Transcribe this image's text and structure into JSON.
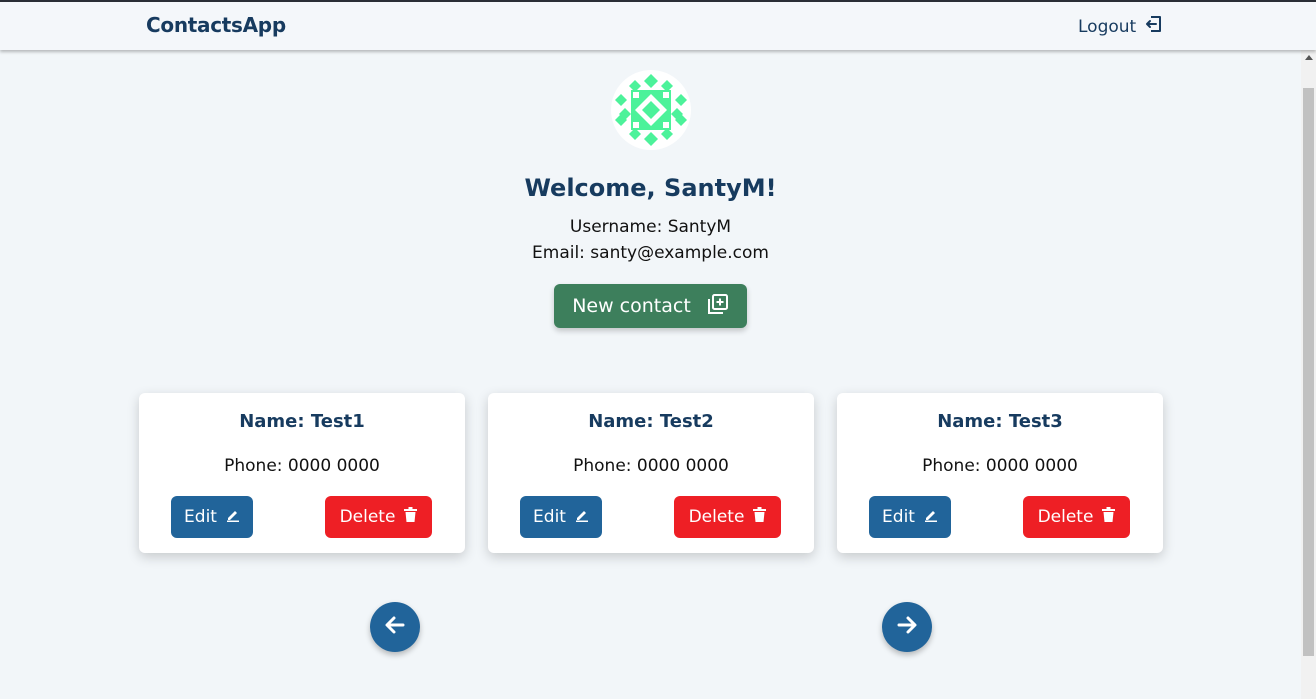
{
  "navbar": {
    "brand": "ContactsApp",
    "logout_label": "Logout"
  },
  "profile": {
    "welcome": "Welcome, SantyM!",
    "username": "Username: SantyM",
    "email": "Email: santy@example.com"
  },
  "actions": {
    "new_contact_label": "New contact"
  },
  "contacts": [
    {
      "name": "Name: Test1",
      "phone": "Phone: 0000 0000",
      "edit_label": "Edit",
      "delete_label": "Delete"
    },
    {
      "name": "Name: Test2",
      "phone": "Phone: 0000 0000",
      "edit_label": "Edit",
      "delete_label": "Delete"
    },
    {
      "name": "Name: Test3",
      "phone": "Phone: 0000 0000",
      "edit_label": "Edit",
      "delete_label": "Delete"
    }
  ],
  "pagination": {
    "prev_icon": "arrow-left-icon",
    "next_icon": "arrow-right-icon"
  },
  "colors": {
    "brand": "#173b5f",
    "new_contact": "#3d7f5c",
    "edit": "#21649a",
    "delete": "#ee1f25",
    "avatar_pattern": "#4cf29a"
  }
}
